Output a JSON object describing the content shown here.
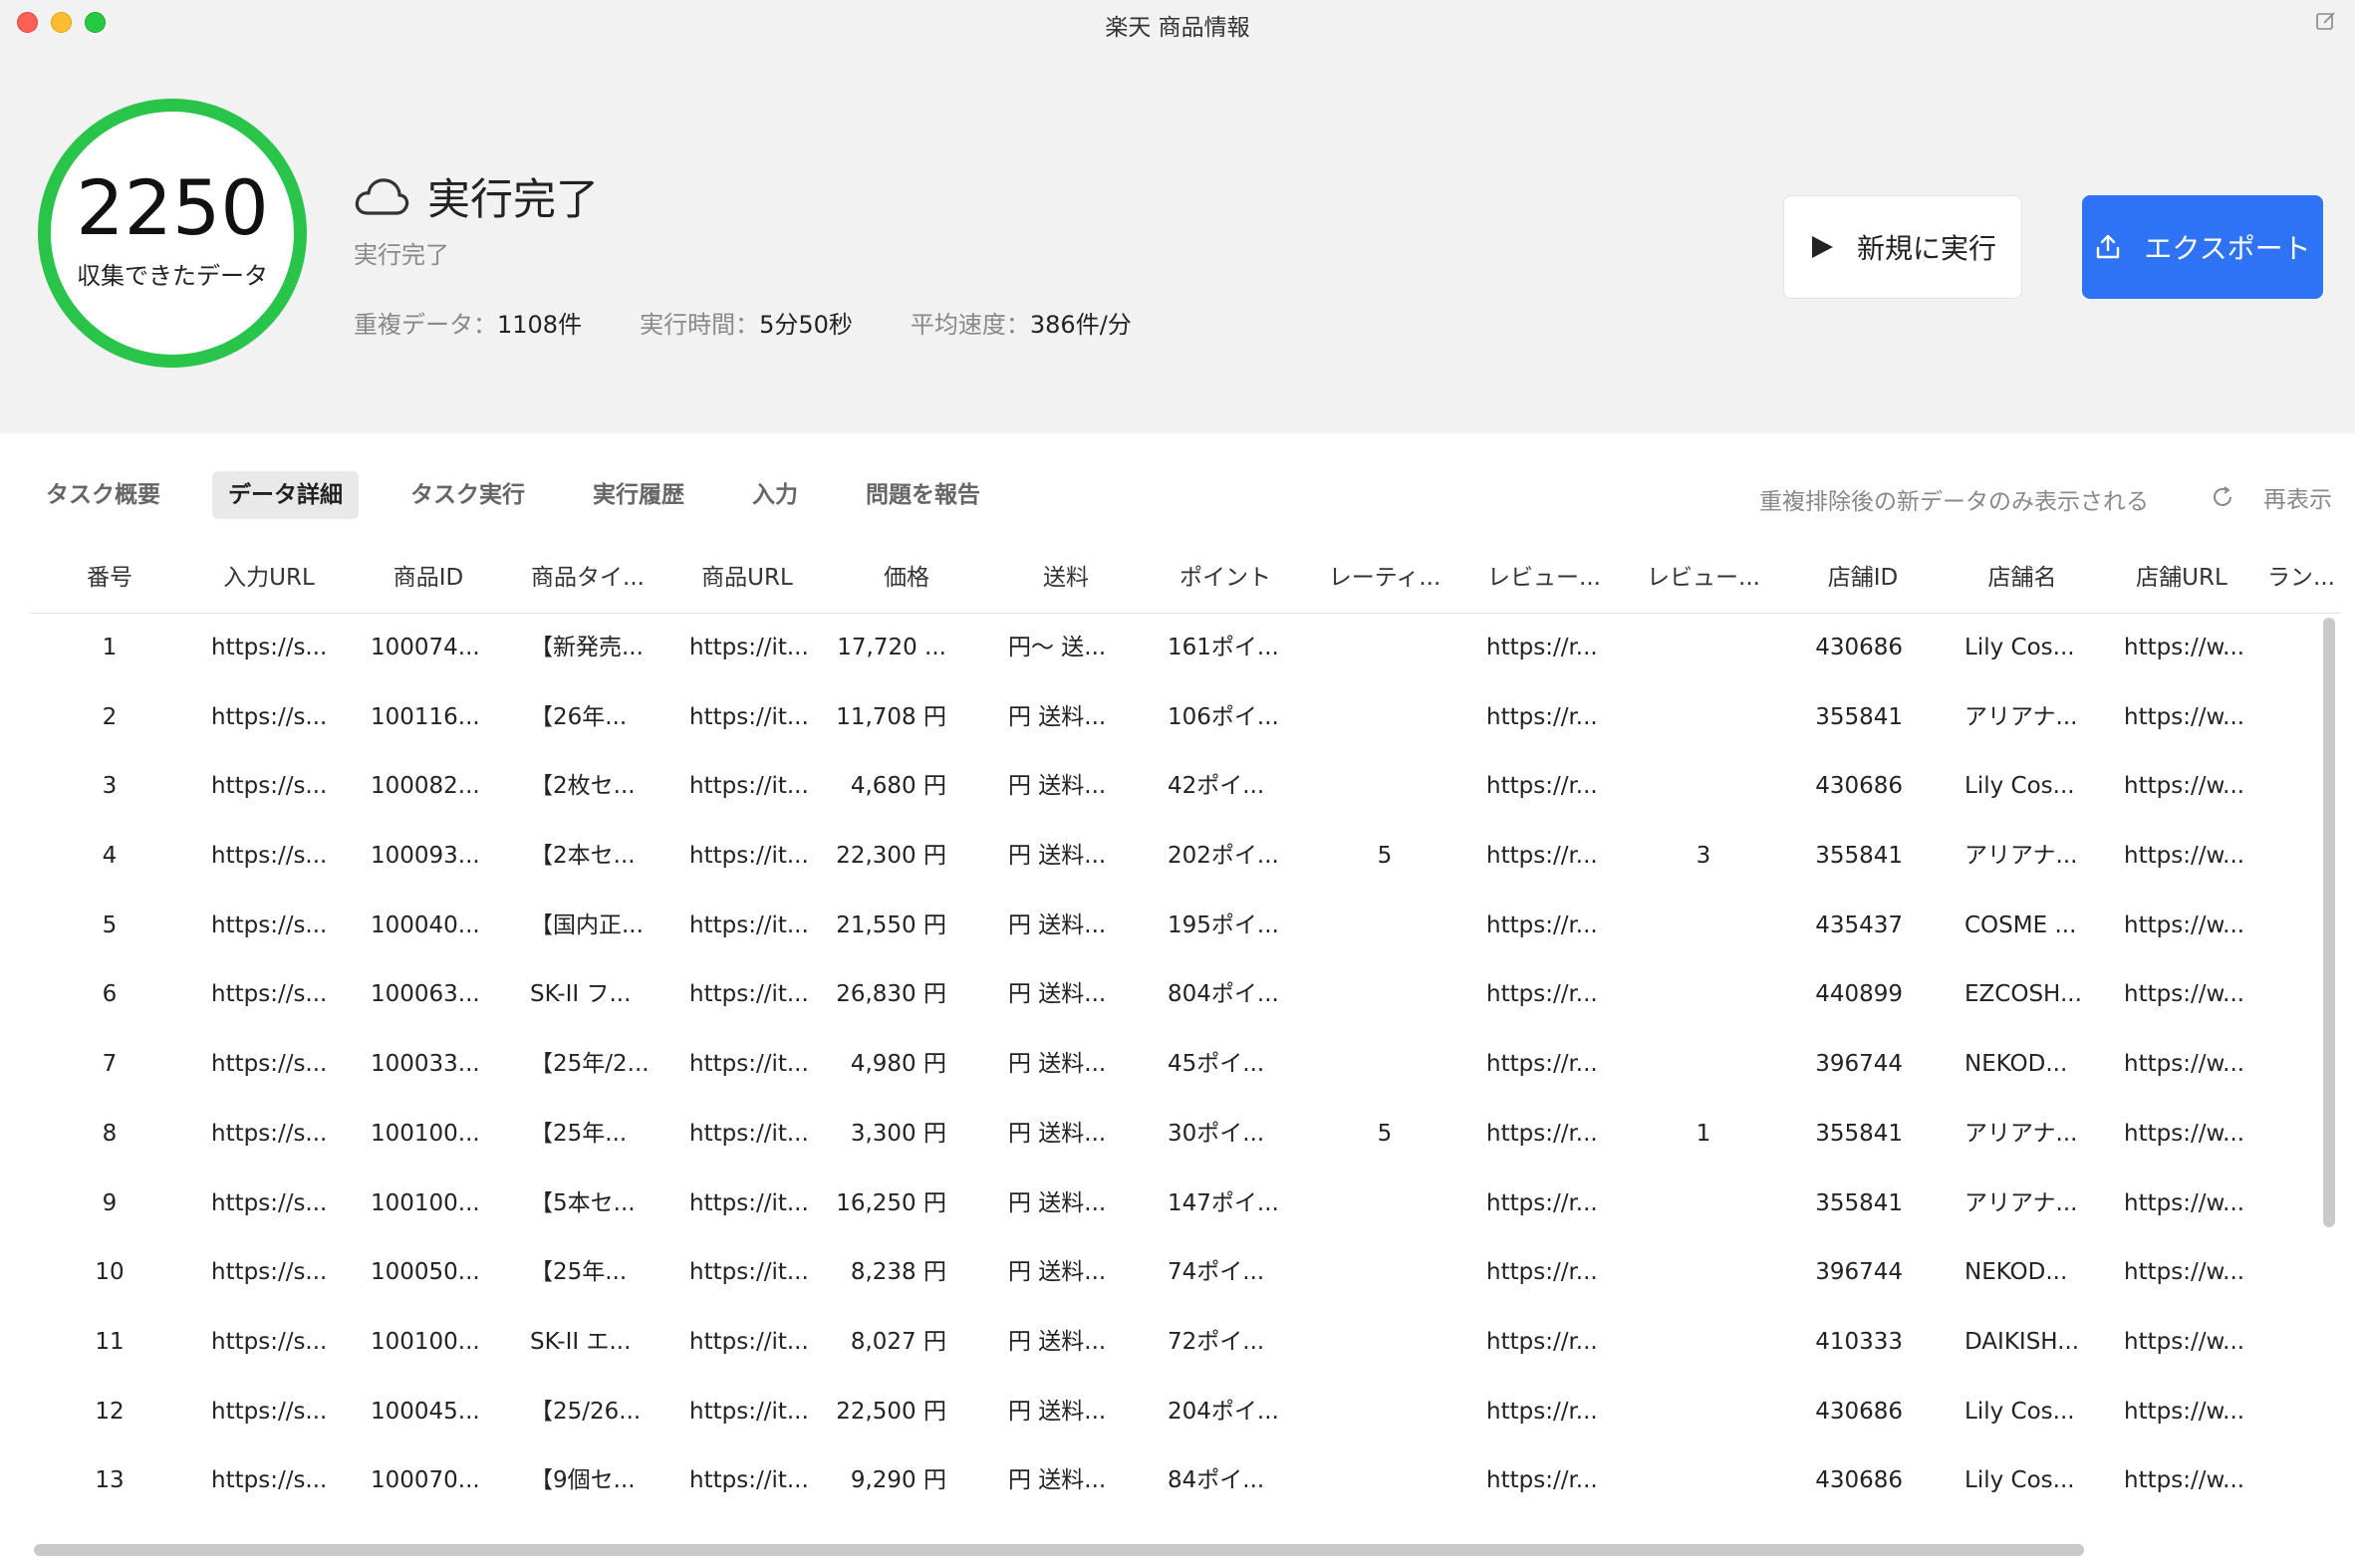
{
  "window": {
    "title": "楽天 商品情報"
  },
  "summary": {
    "count": "2250",
    "count_label": "収集できたデータ",
    "status_title": "実行完了",
    "status_sub": "実行完了",
    "stats": [
      {
        "label": "重複データ：",
        "value": "1108件"
      },
      {
        "label": "実行時間：",
        "value": "5分50秒"
      },
      {
        "label": "平均速度：",
        "value": "386件/分"
      }
    ],
    "ring_color": "#29c44a"
  },
  "actions": {
    "new_run": "新規に実行",
    "export": "エクスポート",
    "accent": "#2f73f5"
  },
  "tabs": [
    "タスク概要",
    "データ詳細",
    "タスク実行",
    "実行履歴",
    "入力",
    "問題を報告"
  ],
  "active_tab": "データ詳細",
  "toolbar": {
    "notice": "重複排除後の新データのみ表示される",
    "refresh": "再表示"
  },
  "table": {
    "columns": [
      "番号",
      "入力URL",
      "商品ID",
      "商品タイ...",
      "商品URL",
      "価格",
      "送料",
      "ポイント",
      "レーティ...",
      "レビュー...",
      "レビュー...",
      "店舗ID",
      "店舗名",
      "店舗URL",
      "ラン..."
    ],
    "rows": [
      [
        "1",
        "https://s...",
        "100074...",
        "【新発売...",
        "https://it...",
        "17,720 ...",
        "円〜 送...",
        "161ポイ...",
        "",
        "https://r...",
        "",
        "430686",
        "Lily Cos...",
        "https://w...",
        ""
      ],
      [
        "2",
        "https://s...",
        "100116...",
        "【26年...",
        "https://it...",
        "11,708 円",
        "円 送料...",
        "106ポイ...",
        "",
        "https://r...",
        "",
        "355841",
        "アリアナ...",
        "https://w...",
        ""
      ],
      [
        "3",
        "https://s...",
        "100082...",
        "【2枚セ...",
        "https://it...",
        "4,680 円",
        "円 送料...",
        "42ポイ...",
        "",
        "https://r...",
        "",
        "430686",
        "Lily Cos...",
        "https://w...",
        ""
      ],
      [
        "4",
        "https://s...",
        "100093...",
        "【2本セ...",
        "https://it...",
        "22,300 円",
        "円 送料...",
        "202ポイ...",
        "5",
        "https://r...",
        "3",
        "355841",
        "アリアナ...",
        "https://w...",
        ""
      ],
      [
        "5",
        "https://s...",
        "100040...",
        "【国内正...",
        "https://it...",
        "21,550 円",
        "円 送料...",
        "195ポイ...",
        "",
        "https://r...",
        "",
        "435437",
        "COSME ...",
        "https://w...",
        ""
      ],
      [
        "6",
        "https://s...",
        "100063...",
        "SK-II フ...",
        "https://it...",
        "26,830 円",
        "円 送料...",
        "804ポイ...",
        "",
        "https://r...",
        "",
        "440899",
        "EZCOSH...",
        "https://w...",
        ""
      ],
      [
        "7",
        "https://s...",
        "100033...",
        "【25年/2...",
        "https://it...",
        "4,980 円",
        "円 送料...",
        "45ポイ...",
        "",
        "https://r...",
        "",
        "396744",
        "NEKOD...",
        "https://w...",
        ""
      ],
      [
        "8",
        "https://s...",
        "100100...",
        "【25年...",
        "https://it...",
        "3,300 円",
        "円 送料...",
        "30ポイ...",
        "5",
        "https://r...",
        "1",
        "355841",
        "アリアナ...",
        "https://w...",
        ""
      ],
      [
        "9",
        "https://s...",
        "100100...",
        "【5本セ...",
        "https://it...",
        "16,250 円",
        "円 送料...",
        "147ポイ...",
        "",
        "https://r...",
        "",
        "355841",
        "アリアナ...",
        "https://w...",
        ""
      ],
      [
        "10",
        "https://s...",
        "100050...",
        "【25年...",
        "https://it...",
        "8,238 円",
        "円 送料...",
        "74ポイ...",
        "",
        "https://r...",
        "",
        "396744",
        "NEKOD...",
        "https://w...",
        ""
      ],
      [
        "11",
        "https://s...",
        "100100...",
        "SK-II エ...",
        "https://it...",
        "8,027 円",
        "円 送料...",
        "72ポイ...",
        "",
        "https://r...",
        "",
        "410333",
        "DAIKISH...",
        "https://w...",
        ""
      ],
      [
        "12",
        "https://s...",
        "100045...",
        "【25/26...",
        "https://it...",
        "22,500 円",
        "円 送料...",
        "204ポイ...",
        "",
        "https://r...",
        "",
        "430686",
        "Lily Cos...",
        "https://w...",
        ""
      ],
      [
        "13",
        "https://s...",
        "100070...",
        "【9個セ...",
        "https://it...",
        "9,290 円",
        "円 送料...",
        "84ポイ...",
        "",
        "https://r...",
        "",
        "430686",
        "Lily Cos...",
        "https://w...",
        ""
      ]
    ]
  }
}
